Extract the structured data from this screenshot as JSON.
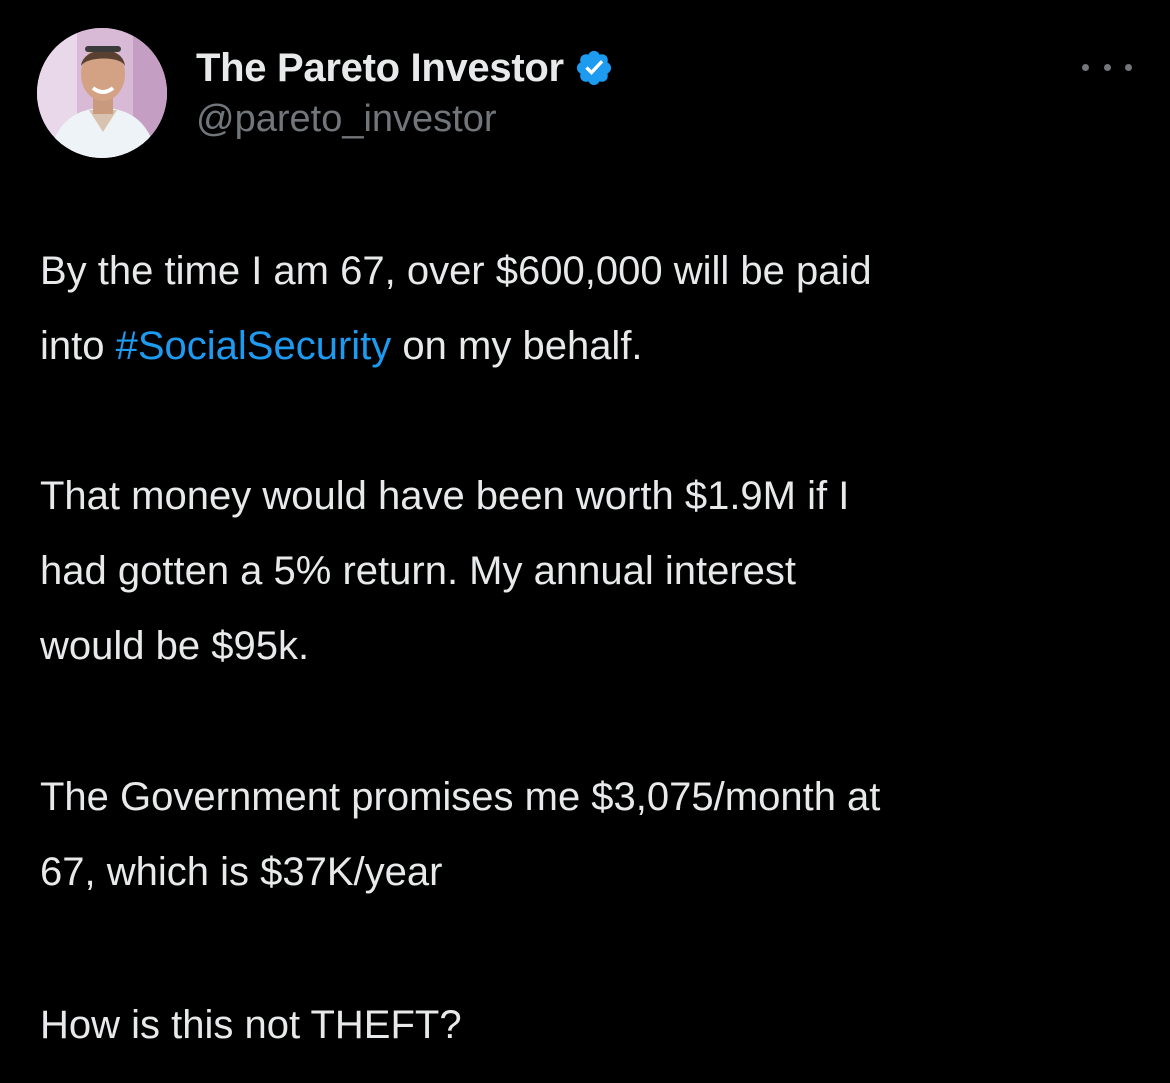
{
  "author": {
    "display_name": "The Pareto Investor",
    "handle": "@pareto_investor",
    "verified": true,
    "avatar_icon": "profile-photo"
  },
  "more_icon": "more-horizontal-icon",
  "tweet": {
    "p1": {
      "line1": "By the time I am 67, over $600,000 will be paid",
      "line2_pre": "into ",
      "hashtag": "#SocialSecurity",
      "line2_post": " on my behalf."
    },
    "p2": {
      "line1": "That money would have been worth $1.9M if I",
      "line2": "had gotten a 5% return. My annual interest",
      "line3": "would be $95k."
    },
    "p3": {
      "line1": "The Government promises me $3,075/month at",
      "line2": "67, which is $37K/year"
    },
    "p4": {
      "line1": "How is this not THEFT?"
    }
  },
  "colors": {
    "background": "#000000",
    "text": "#e7e9ea",
    "secondary": "#71767b",
    "accent": "#1d9bf0"
  }
}
